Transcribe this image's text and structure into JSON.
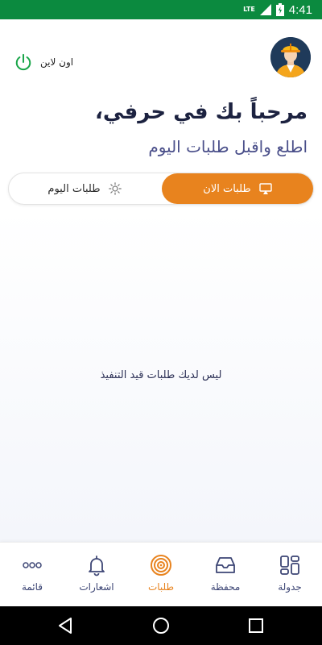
{
  "status_bar": {
    "network": "LTE",
    "time": "4:41"
  },
  "header": {
    "online_label": "اون لاين",
    "welcome": "مرحباً بك في حرفي،",
    "subtitle": "اطلع واقبل طلبات اليوم"
  },
  "tabs": {
    "now": "طلبات الان",
    "today": "طلبات اليوم"
  },
  "content": {
    "empty_message": "ليس لديك طلبات قيد التنفيذ"
  },
  "bottom_nav": {
    "menu": "قائمة",
    "notifications": "اشعارات",
    "orders": "طلبات",
    "wallet": "محفظة",
    "schedule": "جدولة"
  },
  "colors": {
    "accent": "#e8831e",
    "status_bar": "#0b8a3f",
    "online_green": "#1aa64a",
    "nav_text": "#3d4675"
  }
}
